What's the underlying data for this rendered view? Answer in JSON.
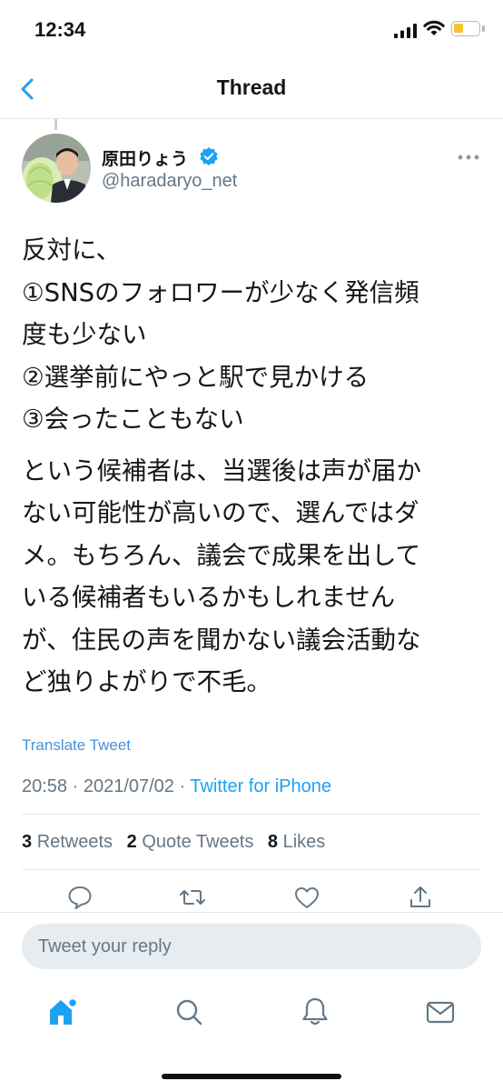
{
  "status_bar": {
    "time": "12:34"
  },
  "nav": {
    "title": "Thread"
  },
  "author": {
    "name": "原田りょう",
    "handle": "@haradaryo_net"
  },
  "tweet": {
    "lines_para1": [
      "反対に、",
      "①SNSのフォロワーが少なく発信頻",
      "度も少ない",
      "②選挙前にやっと駅で見かける",
      "③会ったこともない"
    ],
    "lines_para2": [
      "という候補者は、当選後は声が届か",
      "ない可能性が高いので、選んではダ",
      "メ。もちろん、議会で成果を出して",
      "いる候補者もいるかもしれません",
      "が、住民の声を聞かない議会活動な",
      "ど独りよがりで不毛。"
    ],
    "translate_label": "Translate Tweet",
    "timestamp": "20:58 · 2021/07/02 · ",
    "source": "Twitter for iPhone"
  },
  "stats": {
    "retweets_count": "3",
    "retweets_label": "Retweets",
    "quotes_count": "2",
    "quotes_label": "Quote Tweets",
    "likes_count": "8",
    "likes_label": "Likes"
  },
  "reply": {
    "placeholder": "Tweet your reply"
  },
  "colors": {
    "accent": "#1da1f2",
    "secondary_text": "#657786",
    "divider": "#e1e8ed"
  },
  "icons": {
    "actions": [
      "reply-icon",
      "retweet-icon",
      "like-icon",
      "share-icon"
    ],
    "tabs": [
      "home-icon",
      "search-icon",
      "notifications-icon",
      "messages-icon"
    ]
  }
}
